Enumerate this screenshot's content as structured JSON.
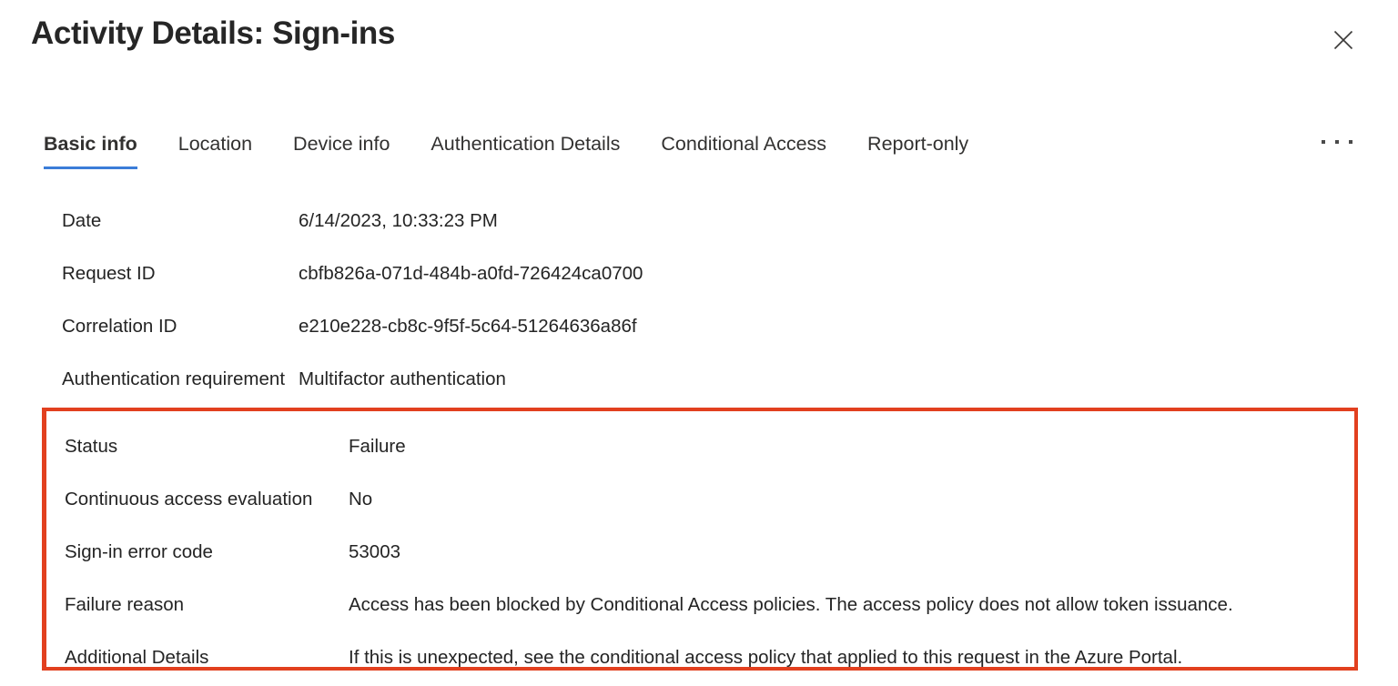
{
  "header": {
    "title": "Activity Details: Sign-ins",
    "close_icon": "close-icon"
  },
  "tabs": {
    "items": [
      {
        "label": "Basic info",
        "active": true
      },
      {
        "label": "Location",
        "active": false
      },
      {
        "label": "Device info",
        "active": false
      },
      {
        "label": "Authentication Details",
        "active": false
      },
      {
        "label": "Conditional Access",
        "active": false
      },
      {
        "label": "Report-only",
        "active": false
      }
    ],
    "overflow_icon": "ellipsis-icon"
  },
  "basic_info": {
    "rows": [
      {
        "label": "Date",
        "value": "6/14/2023, 10:33:23 PM"
      },
      {
        "label": "Request ID",
        "value": "cbfb826a-071d-484b-a0fd-726424ca0700"
      },
      {
        "label": "Correlation ID",
        "value": "e210e228-cb8c-9f5f-5c64-51264636a86f"
      },
      {
        "label": "Authentication requirement",
        "value": "Multifactor authentication"
      }
    ],
    "highlighted_rows": [
      {
        "label": "Status",
        "value": "Failure"
      },
      {
        "label": "Continuous access evaluation",
        "value": "No"
      },
      {
        "label": "Sign-in error code",
        "value": "53003"
      },
      {
        "label": "Failure reason",
        "value": "Access has been blocked by Conditional Access policies. The access policy does not allow token issuance."
      },
      {
        "label": "Additional Details",
        "value": "If this is unexpected, see the conditional access policy that applied to this request in the Azure Portal."
      }
    ]
  },
  "colors": {
    "accent_tab_underline": "#3b7dd8",
    "highlight_border": "#e2401f",
    "text": "#242424"
  }
}
